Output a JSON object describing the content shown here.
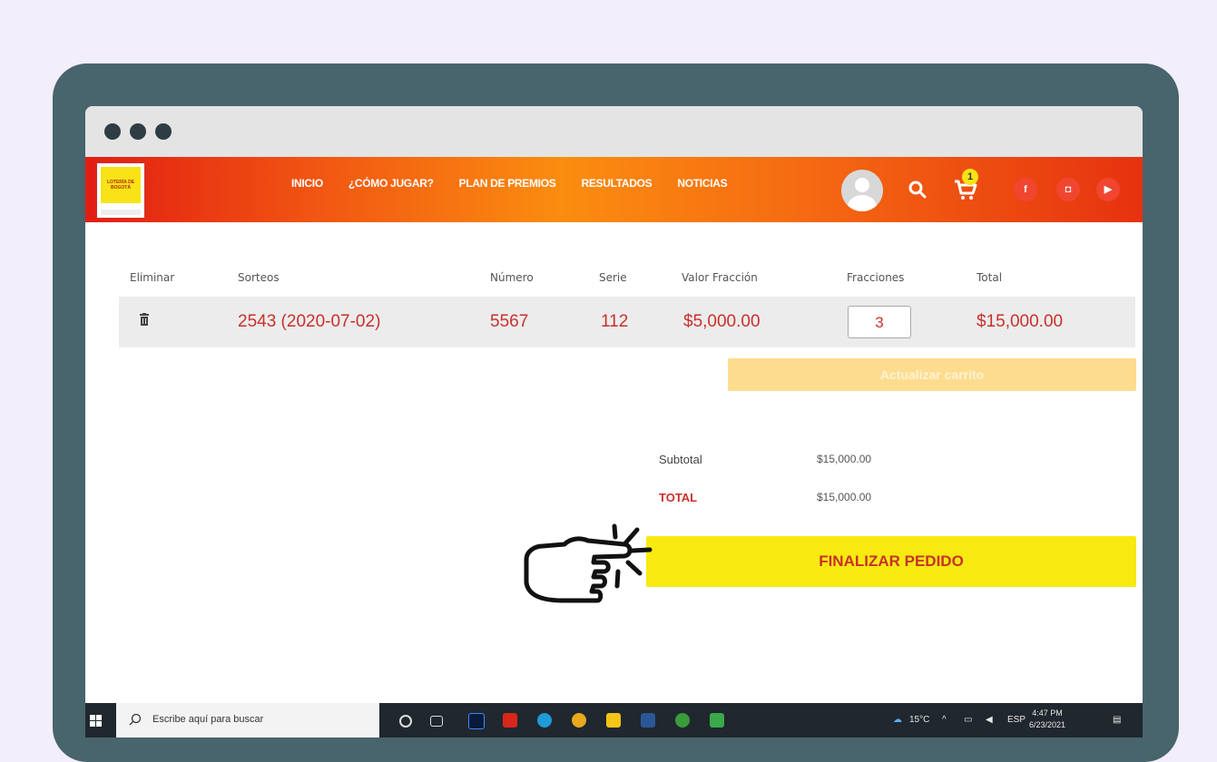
{
  "nav": {
    "logo_text": "LOTERÍA DE BOGOTÁ",
    "links": [
      "INICIO",
      "¿CÓMO JUGAR?",
      "PLAN DE PREMIOS",
      "RESULTADOS",
      "NOTICIAS"
    ],
    "cart_count": "1",
    "social": {
      "facebook": "f",
      "instagram": "◘",
      "youtube": "▶"
    }
  },
  "cart": {
    "headers": [
      "Eliminar",
      "Sorteos",
      "Número",
      "Serie",
      "Valor Fracción",
      "Fracciones",
      "Total"
    ],
    "row": {
      "sorteo": "2543 (2020-07-02)",
      "numero": "5567",
      "serie": "112",
      "valor": "$5,000.00",
      "fracciones": "3",
      "total": "$15,000.00"
    },
    "update_label": "Actualizar carrito"
  },
  "totals": {
    "subtotal_label": "Subtotal",
    "subtotal_value": "$15,000.00",
    "total_label": "TOTAL",
    "total_value": "$15,000.00"
  },
  "checkout_label": "FINALIZAR PEDIDO",
  "taskbar": {
    "search_placeholder": "Escribe aquí para buscar",
    "weather": "15°C",
    "lang": "ESP",
    "time": "4:47 PM",
    "date": "6/23/2021"
  },
  "colors": {
    "accent": "#c8312b",
    "checkout": "#f8ea10",
    "frame": "#48646c"
  }
}
